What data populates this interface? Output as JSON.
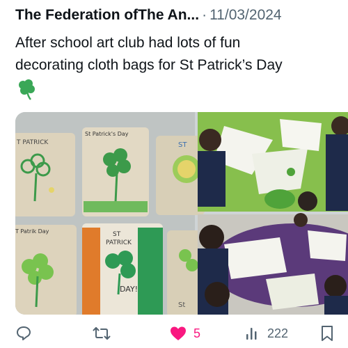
{
  "tweet": {
    "author": "The Federation ofThe An...",
    "separator": "·",
    "date": "11/03/2024",
    "text_line1": "After school art club had lots of fun",
    "text_line2": "decorating cloth bags for St Patrick’s Day",
    "emoji": "shamrock"
  },
  "media": {
    "photo1": {
      "bag_top_left_label": "T PATRICK",
      "bag_top_middle_label": "St Patrick's Day",
      "bag_top_right_label": "ST",
      "bag_bottom_left_label": "T Patrik Day",
      "bag_bottom_middle_label_top": "ST",
      "bag_bottom_middle_label_mid": "PATRICK",
      "bag_bottom_middle_label_bottom": "DAY!",
      "bag_bottom_right_label": "St"
    }
  },
  "actions": {
    "reply": {
      "icon": "reply-icon",
      "count": ""
    },
    "retweet": {
      "icon": "retweet-icon",
      "count": ""
    },
    "like": {
      "icon": "heart-icon",
      "count": "5",
      "color": "#f91880"
    },
    "views": {
      "icon": "views-icon",
      "count": "222"
    },
    "bookmark": {
      "icon": "bookmark-icon",
      "count": ""
    }
  },
  "colors": {
    "text": "#0f1419",
    "muted": "#536471",
    "like": "#f91880",
    "shamrock": "#3aa757"
  }
}
